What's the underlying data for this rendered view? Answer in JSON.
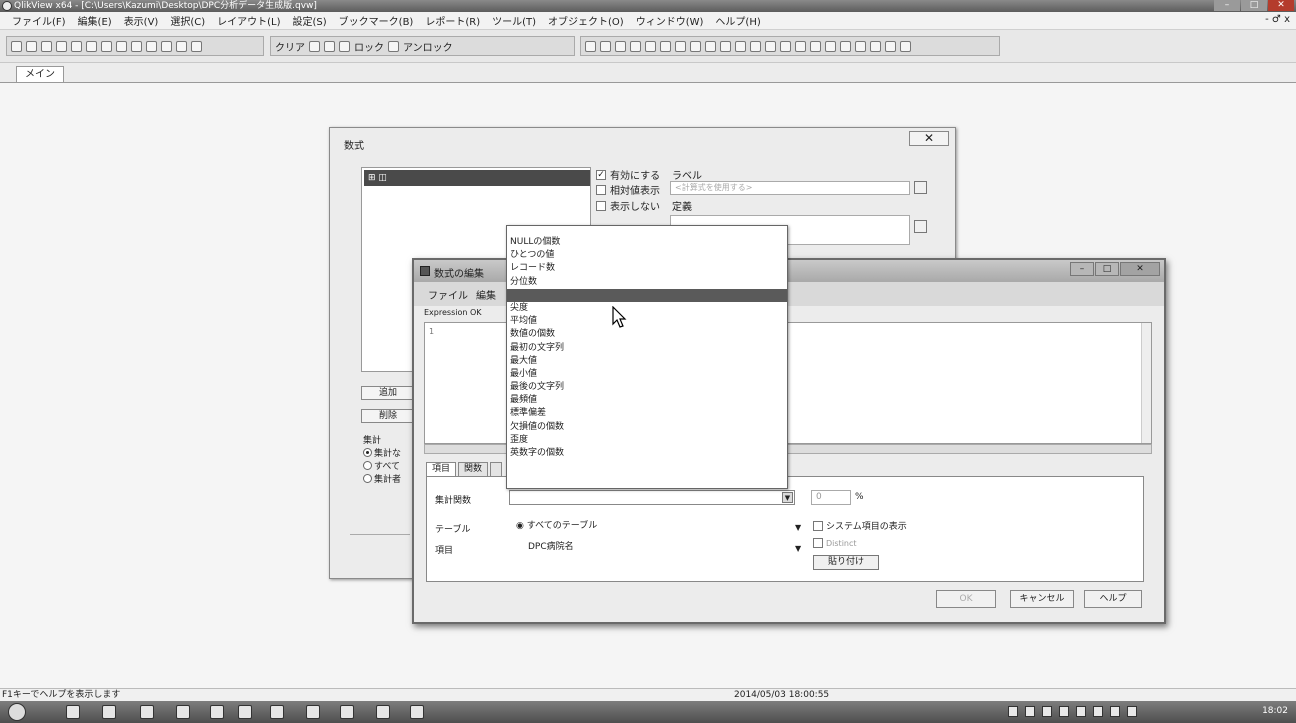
{
  "window": {
    "title": "QlikView x64 - [C:\\Users\\Kazumi\\Desktop\\DPC分析データ生成版.qvw]"
  },
  "menubar": {
    "items": [
      "ファイル(F)",
      "編集(E)",
      "表示(V)",
      "選択(C)",
      "レイアウト(L)",
      "設定(S)",
      "ブックマーク(B)",
      "レポート(R)",
      "ツール(T)",
      "オブジェクト(O)",
      "ウィンドウ(W)",
      "ヘルプ(H)"
    ],
    "mdi_controls": "- ♂ x"
  },
  "toolbar": {
    "clear_label": "クリア",
    "lock_label": "ロック",
    "unlock_label": "アンロック"
  },
  "sheet": {
    "tab_label": "メイン"
  },
  "formula_dialog": {
    "title": "数式",
    "enable_label": "有効にする",
    "relative_label": "相対値表示",
    "hide_label": "表示しない",
    "label_caption": "ラベル",
    "label_placeholder": "<計算式を使用する>",
    "definition_caption": "定義",
    "add_button": "追加",
    "delete_button": "削除",
    "aggregation_label": "集計",
    "radio_1": "集計な",
    "radio_2": "すべて",
    "radio_3": "集計者"
  },
  "edit_dialog": {
    "title": "数式の編集",
    "menu_file": "ファイル",
    "menu_edit": "編集",
    "status": "Expression OK",
    "line_number": "1",
    "tabs": [
      "項目",
      "関数",
      ""
    ],
    "agg_function_label": "集計関数",
    "pct_value": "0",
    "pct_sign": "%",
    "table_label": "テーブル",
    "table_value": "すべてのテーブル",
    "field_label": "項目",
    "field_value": "DPC病院名",
    "system_fields_label": "システム項目の表示",
    "distinct_label": "Distinct",
    "paste_button": "貼り付け",
    "ok_button": "OK",
    "cancel_button": "キャンセル",
    "help_button": "ヘルプ"
  },
  "dropdown": {
    "options": [
      "NULLの個数",
      "ひとつの値",
      "レコード数",
      "分位数",
      "",
      "尖度",
      "平均値",
      "数値の個数",
      "最初の文字列",
      "最大値",
      "最小値",
      "最後の文字列",
      "最頻値",
      "標準偏差",
      "欠損値の個数",
      "歪度",
      "英数字の個数"
    ],
    "selected_index": 4
  },
  "statusbar": {
    "hint": "F1キーでヘルプを表示します",
    "timestamp": "2014/05/03 18:00:55"
  },
  "taskbar": {
    "clock": "18:02"
  },
  "colors": {
    "selection": "#5a5a5a",
    "title_gradient_top": "#8a8a8a"
  }
}
